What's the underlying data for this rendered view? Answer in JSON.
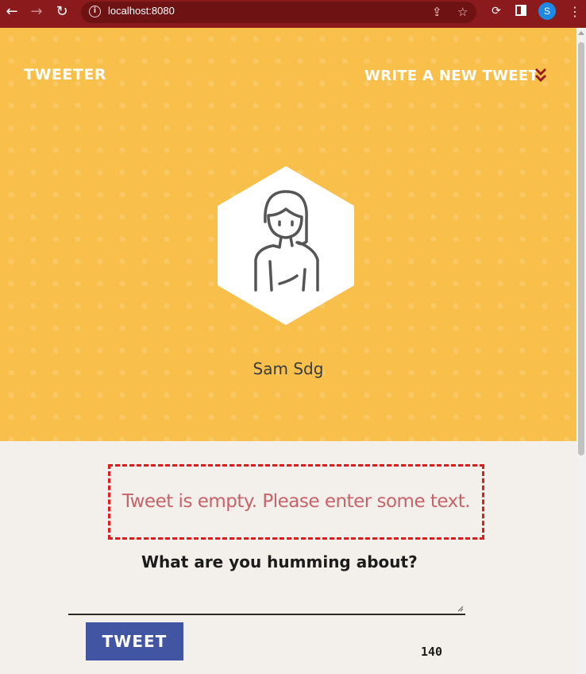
{
  "browser": {
    "url": "localhost:8080",
    "profile_initial": "S",
    "icons": [
      "back-arrow-icon",
      "forward-arrow-icon",
      "reload-icon",
      "info-icon",
      "share-icon",
      "star-icon",
      "extension-icon",
      "sidebar-icon",
      "menu-icon"
    ]
  },
  "header": {
    "brand": "TWEETER",
    "compose_label": "WRITE A NEW TWEET",
    "compose_icon": "double-chevron-down-icon",
    "accent": "#f8c04b"
  },
  "profile": {
    "name": "Sam Sdg",
    "avatar_icon": "user-avatar-icon"
  },
  "composer": {
    "error_message": "Tweet is empty. Please enter some text.",
    "prompt": "What are you humming about?",
    "text_value": "",
    "submit_label": "TWEET",
    "char_counter": "140",
    "button_color": "#4255a3",
    "error_color": "#dd1d1d"
  }
}
